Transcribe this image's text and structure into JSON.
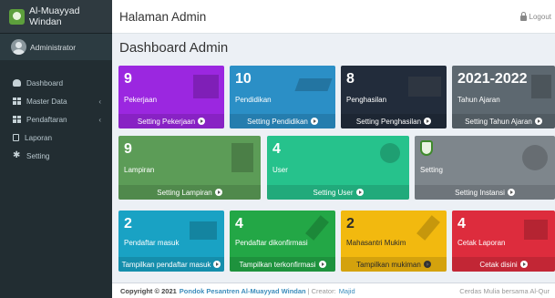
{
  "brand": {
    "name": "Al-Muayyad Windan"
  },
  "user": {
    "name": "Administrator"
  },
  "sidebar": {
    "items": [
      {
        "label": "Dashboard",
        "icon": "dashboard-icon",
        "has_submenu": false
      },
      {
        "label": "Master Data",
        "icon": "table-icon",
        "has_submenu": true
      },
      {
        "label": "Pendaftaran",
        "icon": "table-icon",
        "has_submenu": true
      },
      {
        "label": "Laporan",
        "icon": "file-icon",
        "has_submenu": false
      },
      {
        "label": "Setting",
        "icon": "gear-icon",
        "has_submenu": false
      }
    ]
  },
  "header": {
    "title": "Halaman Admin",
    "logout": "Logout"
  },
  "page": {
    "title": "Dashboard Admin"
  },
  "row1": [
    {
      "value": "9",
      "label": "Pekerjaan",
      "link": "Setting Pekerjaan",
      "color": "#9b27e0",
      "icon": "building-icon"
    },
    {
      "value": "10",
      "label": "Pendidikan",
      "link": "Setting Pendidikan",
      "color": "#2b8fc6",
      "icon": "graduation-cap-icon"
    },
    {
      "value": "8",
      "label": "Penghasilan",
      "link": "Setting Penghasilan",
      "color": "#222c3b",
      "icon": "money-icon"
    },
    {
      "value": "2021-2022",
      "label": "Tahun Ajaran",
      "link": "Setting Tahun Ajaran",
      "color": "#5d6870",
      "icon": "calendar-icon"
    }
  ],
  "row2": [
    {
      "value": "9",
      "label": "Lampiran",
      "link": "Setting Lampiran",
      "color": "#5c9c57",
      "icon": "file-icon"
    },
    {
      "value": "4",
      "label": "User",
      "link": "Setting User",
      "color": "#26c28c",
      "icon": "user-icon"
    },
    {
      "value": "",
      "label": "Setting",
      "link": "Setting Instansi",
      "color": "#7e868c",
      "icon": "gear-icon"
    }
  ],
  "row3": [
    {
      "value": "2",
      "label": "Pendaftar masuk",
      "link": "Tampilkan pendaftar masuk",
      "color": "#19a2c4",
      "icon": "download-icon"
    },
    {
      "value": "4",
      "label": "Pendaftar dikonfirmasi",
      "link": "Tampilkan terkonfirmasi",
      "color": "#23a746",
      "icon": "check-icon"
    },
    {
      "value": "2",
      "label": "Mahasantri Mukim",
      "link": "Tampilkan mukiman",
      "color": "#f2b90f",
      "icon": "check-icon"
    },
    {
      "value": "4",
      "label": "Cetak Laporan",
      "link": "Cetak disini",
      "color": "#dd2c3d",
      "icon": "print-icon"
    }
  ],
  "footer": {
    "copyright": "Copyright © 2021",
    "org": "Pondok Pesantren Al-Muayyad Windan",
    "sep": "|",
    "creator": "Creator:",
    "creator_name": "Majid",
    "tagline": "Cerdas Mulia bersama Al-Qur"
  }
}
